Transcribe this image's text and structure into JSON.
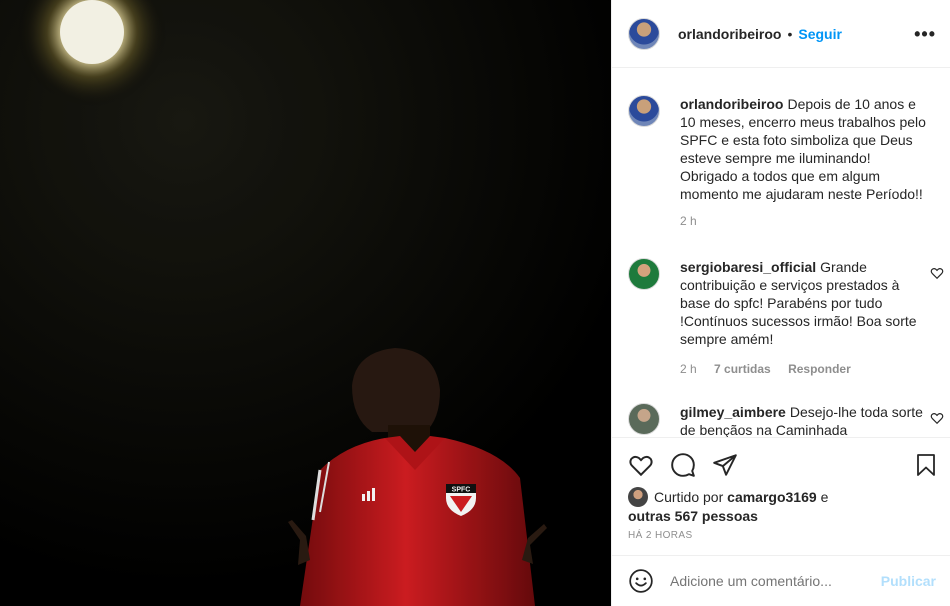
{
  "post": {
    "image_alt": "Foto: homem com camisa vermelha do SPFC sob um refletor"
  },
  "header": {
    "username": "orlandoribeiroo",
    "separator": "•",
    "follow_label": "Seguir",
    "more_label": "•••"
  },
  "caption": {
    "author": "orlandoribeiroo",
    "text": "Depois de 10 anos e 10 meses, encerro meus trabalhos pelo SPFC e esta foto simboliza que Deus esteve sempre me iluminando! Obrigado a todos que em algum momento me ajudaram neste Período!!",
    "time": "2 h"
  },
  "comments": [
    {
      "author": "sergiobaresi_official",
      "text": "Grande contribuição e serviços prestados à base do spfc! Parabéns por tudo !Contínuos sucessos irmão! Boa sorte sempre amém!",
      "time": "2 h",
      "likes": "7 curtidas",
      "reply_label": "Responder"
    },
    {
      "author": "gilmey_aimbere",
      "text": "Desejo-lhe toda sorte de bençãos na Caminhada"
    }
  ],
  "likes": {
    "prefix": "Curtido por",
    "user": "camargo3169",
    "conjunction": "e",
    "others": "outras 567 pessoas"
  },
  "timestamp": "HÁ 2 HORAS",
  "add_comment": {
    "placeholder": "Adicione um comentário...",
    "post_label": "Publicar"
  },
  "shirt_badge": "SPFC",
  "colors": {
    "accent": "#0095f6",
    "publish_disabled": "#b2dffc",
    "shirt": "#c8181c"
  }
}
